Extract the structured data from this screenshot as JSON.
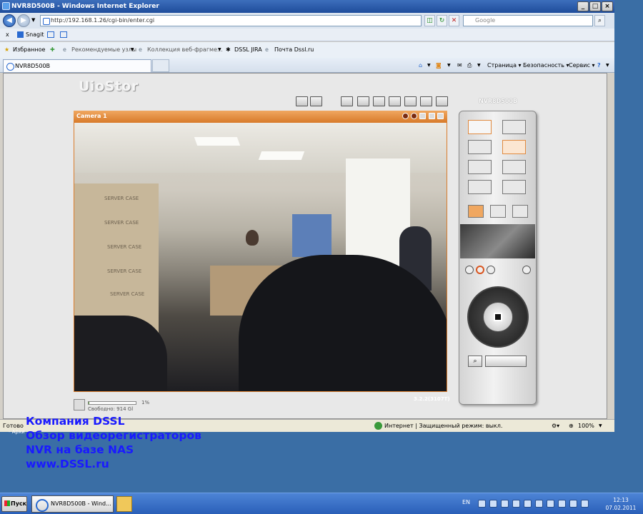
{
  "window": {
    "title": "NVR8D500B - Windows Internet Explorer"
  },
  "address": {
    "url": "http://192.168.1.26/cgi-bin/enter.cgi",
    "search_placeholder": "Google"
  },
  "snagit": {
    "label": "Snagit"
  },
  "favorites": {
    "label": "Избранное",
    "items": [
      "Рекомендуемые узлы",
      "Коллекция веб-фрагме...",
      "DSSL JIRA",
      "Почта Dssl.ru"
    ]
  },
  "tabs": [
    {
      "label": "NVR8D500B"
    }
  ],
  "commands": {
    "page": "Страница",
    "safety": "Безопасность",
    "tools": "Сервис"
  },
  "app": {
    "logo": "UioStor",
    "device_name": "NVR8D500B",
    "camera_title": "Camera 1",
    "version": "3.2.2(3107T)"
  },
  "storage": {
    "free_label": "Свободно: 914 Gl",
    "percent": "1%",
    "used_fraction": 0.01
  },
  "video_labels": [
    "SERVER CASE",
    "SERVER CASE",
    "SERVER CASE",
    "SERVER CASE",
    "SERVER CASE"
  ],
  "status": {
    "text": "Готово",
    "zone": "Интернет | Защищенный режим: выкл.",
    "zoom": "100%"
  },
  "desktop": {
    "partial_label": "- Архи"
  },
  "overlay": {
    "lines": [
      "Компания  DSSL",
      "Обзор  видеорегистраторов",
      "NVR на базе NAS",
      "www.DSSL.ru"
    ]
  },
  "taskbar": {
    "start": "Пуск",
    "task": "NVR8D500B - Wind...",
    "lang": "EN",
    "time": "12:13",
    "date": "07.02.2011"
  }
}
